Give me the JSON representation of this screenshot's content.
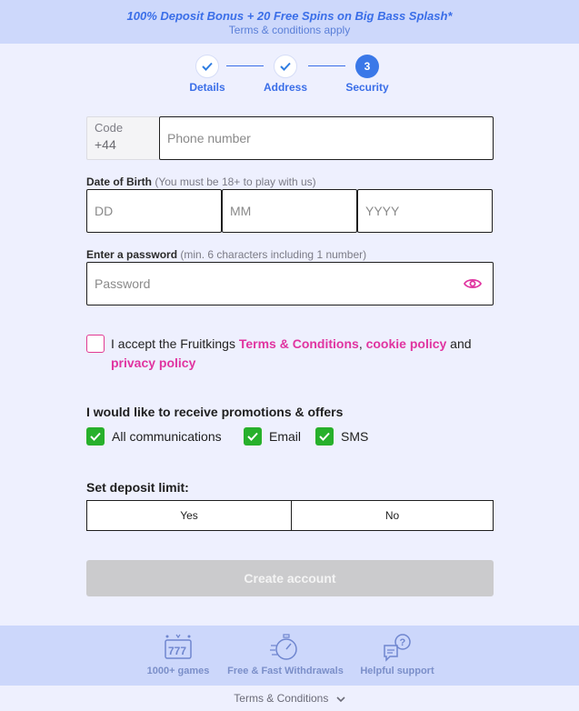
{
  "banner": {
    "title": "100% Deposit Bonus + 20 Free Spins on Big Bass Splash*",
    "subtitle": "Terms & conditions apply"
  },
  "stepper": {
    "steps": [
      {
        "label": "Details",
        "state": "done"
      },
      {
        "label": "Address",
        "state": "done"
      },
      {
        "label": "Security",
        "state": "active",
        "number": "3"
      }
    ]
  },
  "phone": {
    "code_label": "Code",
    "code_value": "+44",
    "placeholder": "Phone number"
  },
  "dob": {
    "label": "Date of Birth",
    "hint": "(You must be 18+ to play with us)",
    "dd_placeholder": "DD",
    "mm_placeholder": "MM",
    "yyyy_placeholder": "YYYY"
  },
  "password": {
    "label": "Enter a password",
    "hint": "(min. 6 characters including 1 number)",
    "placeholder": "Password"
  },
  "accept": {
    "prefix": "I accept the Fruitkings ",
    "terms_link": "Terms & Conditions",
    "comma": ", ",
    "cookie_link": "cookie policy",
    "and": " and ",
    "privacy_link": "privacy policy"
  },
  "promotions": {
    "title": "I would like to receive promotions & offers",
    "options": [
      {
        "label": "All communications",
        "checked": true
      },
      {
        "label": "Email",
        "checked": true
      },
      {
        "label": "SMS",
        "checked": true
      }
    ]
  },
  "deposit": {
    "title": "Set deposit limit:",
    "yes_label": "Yes",
    "no_label": "No"
  },
  "create_button": "Create account",
  "features": [
    {
      "label": "1000+ games",
      "icon": "slot-machine-icon"
    },
    {
      "label": "Free & Fast Withdrawals",
      "icon": "stopwatch-icon"
    },
    {
      "label": "Helpful support",
      "icon": "chat-question-icon"
    }
  ],
  "footer": {
    "terms_label": "Terms & Conditions"
  },
  "colors": {
    "accent_blue": "#3a6ee8",
    "link_pink": "#e034a0",
    "check_green": "#27b02b",
    "background": "#eef0fe"
  }
}
